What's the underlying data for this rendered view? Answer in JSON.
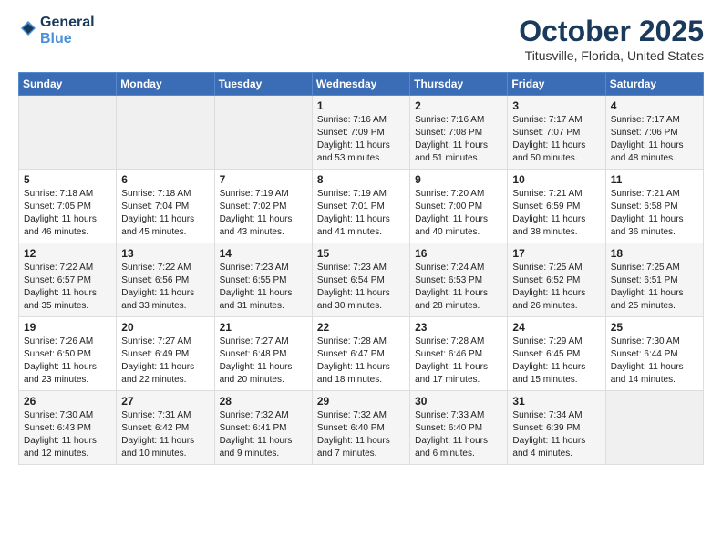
{
  "header": {
    "logo_line1": "General",
    "logo_line2": "Blue",
    "month": "October 2025",
    "location": "Titusville, Florida, United States"
  },
  "weekdays": [
    "Sunday",
    "Monday",
    "Tuesday",
    "Wednesday",
    "Thursday",
    "Friday",
    "Saturday"
  ],
  "weeks": [
    [
      {
        "day": "",
        "info": ""
      },
      {
        "day": "",
        "info": ""
      },
      {
        "day": "",
        "info": ""
      },
      {
        "day": "1",
        "info": "Sunrise: 7:16 AM\nSunset: 7:09 PM\nDaylight: 11 hours and 53 minutes."
      },
      {
        "day": "2",
        "info": "Sunrise: 7:16 AM\nSunset: 7:08 PM\nDaylight: 11 hours and 51 minutes."
      },
      {
        "day": "3",
        "info": "Sunrise: 7:17 AM\nSunset: 7:07 PM\nDaylight: 11 hours and 50 minutes."
      },
      {
        "day": "4",
        "info": "Sunrise: 7:17 AM\nSunset: 7:06 PM\nDaylight: 11 hours and 48 minutes."
      }
    ],
    [
      {
        "day": "5",
        "info": "Sunrise: 7:18 AM\nSunset: 7:05 PM\nDaylight: 11 hours and 46 minutes."
      },
      {
        "day": "6",
        "info": "Sunrise: 7:18 AM\nSunset: 7:04 PM\nDaylight: 11 hours and 45 minutes."
      },
      {
        "day": "7",
        "info": "Sunrise: 7:19 AM\nSunset: 7:02 PM\nDaylight: 11 hours and 43 minutes."
      },
      {
        "day": "8",
        "info": "Sunrise: 7:19 AM\nSunset: 7:01 PM\nDaylight: 11 hours and 41 minutes."
      },
      {
        "day": "9",
        "info": "Sunrise: 7:20 AM\nSunset: 7:00 PM\nDaylight: 11 hours and 40 minutes."
      },
      {
        "day": "10",
        "info": "Sunrise: 7:21 AM\nSunset: 6:59 PM\nDaylight: 11 hours and 38 minutes."
      },
      {
        "day": "11",
        "info": "Sunrise: 7:21 AM\nSunset: 6:58 PM\nDaylight: 11 hours and 36 minutes."
      }
    ],
    [
      {
        "day": "12",
        "info": "Sunrise: 7:22 AM\nSunset: 6:57 PM\nDaylight: 11 hours and 35 minutes."
      },
      {
        "day": "13",
        "info": "Sunrise: 7:22 AM\nSunset: 6:56 PM\nDaylight: 11 hours and 33 minutes."
      },
      {
        "day": "14",
        "info": "Sunrise: 7:23 AM\nSunset: 6:55 PM\nDaylight: 11 hours and 31 minutes."
      },
      {
        "day": "15",
        "info": "Sunrise: 7:23 AM\nSunset: 6:54 PM\nDaylight: 11 hours and 30 minutes."
      },
      {
        "day": "16",
        "info": "Sunrise: 7:24 AM\nSunset: 6:53 PM\nDaylight: 11 hours and 28 minutes."
      },
      {
        "day": "17",
        "info": "Sunrise: 7:25 AM\nSunset: 6:52 PM\nDaylight: 11 hours and 26 minutes."
      },
      {
        "day": "18",
        "info": "Sunrise: 7:25 AM\nSunset: 6:51 PM\nDaylight: 11 hours and 25 minutes."
      }
    ],
    [
      {
        "day": "19",
        "info": "Sunrise: 7:26 AM\nSunset: 6:50 PM\nDaylight: 11 hours and 23 minutes."
      },
      {
        "day": "20",
        "info": "Sunrise: 7:27 AM\nSunset: 6:49 PM\nDaylight: 11 hours and 22 minutes."
      },
      {
        "day": "21",
        "info": "Sunrise: 7:27 AM\nSunset: 6:48 PM\nDaylight: 11 hours and 20 minutes."
      },
      {
        "day": "22",
        "info": "Sunrise: 7:28 AM\nSunset: 6:47 PM\nDaylight: 11 hours and 18 minutes."
      },
      {
        "day": "23",
        "info": "Sunrise: 7:28 AM\nSunset: 6:46 PM\nDaylight: 11 hours and 17 minutes."
      },
      {
        "day": "24",
        "info": "Sunrise: 7:29 AM\nSunset: 6:45 PM\nDaylight: 11 hours and 15 minutes."
      },
      {
        "day": "25",
        "info": "Sunrise: 7:30 AM\nSunset: 6:44 PM\nDaylight: 11 hours and 14 minutes."
      }
    ],
    [
      {
        "day": "26",
        "info": "Sunrise: 7:30 AM\nSunset: 6:43 PM\nDaylight: 11 hours and 12 minutes."
      },
      {
        "day": "27",
        "info": "Sunrise: 7:31 AM\nSunset: 6:42 PM\nDaylight: 11 hours and 10 minutes."
      },
      {
        "day": "28",
        "info": "Sunrise: 7:32 AM\nSunset: 6:41 PM\nDaylight: 11 hours and 9 minutes."
      },
      {
        "day": "29",
        "info": "Sunrise: 7:32 AM\nSunset: 6:40 PM\nDaylight: 11 hours and 7 minutes."
      },
      {
        "day": "30",
        "info": "Sunrise: 7:33 AM\nSunset: 6:40 PM\nDaylight: 11 hours and 6 minutes."
      },
      {
        "day": "31",
        "info": "Sunrise: 7:34 AM\nSunset: 6:39 PM\nDaylight: 11 hours and 4 minutes."
      },
      {
        "day": "",
        "info": ""
      }
    ]
  ]
}
